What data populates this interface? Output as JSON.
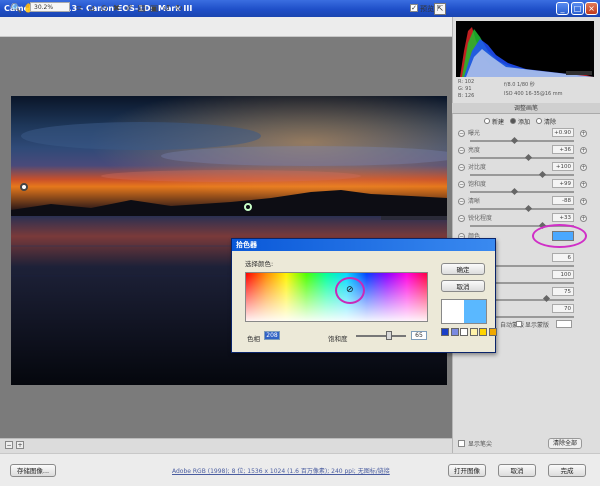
{
  "window": {
    "title": "Camera Raw 5.3 -  Canon EOS-1Ds Mark III",
    "buttons": [
      "_",
      "□",
      "×"
    ]
  },
  "toolbar": {
    "tools": [
      {
        "name": "zoom-tool-icon",
        "glyph": "🔍"
      },
      {
        "name": "hand-tool-icon",
        "glyph": "✋"
      },
      {
        "name": "white-balance-tool-icon",
        "glyph": "✎"
      },
      {
        "name": "color-sampler-tool-icon",
        "glyph": "✎"
      },
      {
        "name": "targeted-adjustment-tool-icon",
        "glyph": "◎"
      },
      {
        "name": "crop-tool-icon",
        "glyph": "⌗"
      },
      {
        "name": "straighten-tool-icon",
        "glyph": "⊿"
      },
      {
        "name": "red-eye-tool-icon",
        "glyph": "⊙"
      },
      {
        "name": "spot-removal-tool-icon",
        "glyph": "✖"
      },
      {
        "name": "adjustment-brush-icon",
        "glyph": "✐"
      },
      {
        "name": "graduated-filter-icon",
        "glyph": "▤"
      },
      {
        "name": "preferences-icon",
        "glyph": "▣"
      },
      {
        "name": "rotate-left-icon",
        "glyph": "↺"
      },
      {
        "name": "rotate-right-icon",
        "glyph": "↻"
      }
    ],
    "preview_label": "预览",
    "preview_checked": true
  },
  "histogram": {
    "rgb_r": "R:  102",
    "rgb_g": "G:   91",
    "rgb_b": "B:  126",
    "exposure": "f/8.0   1/80 秒",
    "iso": "ISO 400   16-35@16 mm"
  },
  "panel": {
    "title": "调整画笔",
    "modes": [
      "新建",
      "添加",
      "清除"
    ],
    "selected_mode": "添加",
    "sliders": [
      {
        "label": "曝光",
        "value": "+0.90"
      },
      {
        "label": "亮度",
        "value": "+36"
      },
      {
        "label": "对比度",
        "value": "+100"
      },
      {
        "label": "饱和度",
        "value": "+99"
      },
      {
        "label": "清晰",
        "value": "-88"
      },
      {
        "label": "锐化程度",
        "value": "+33"
      }
    ],
    "color_label": "颜色",
    "color_value": "#4aa8ff",
    "brush_values": [
      "6",
      "100",
      "75",
      "70"
    ],
    "show_mask_label": "显示蒙版",
    "auto_mask_label": "自动蒙版",
    "show_pins_label": "显示笔尖",
    "clear_all_label": "清除全部"
  },
  "canvas": {
    "zoom": "30.2%"
  },
  "footer": {
    "save_label": "存储图像...",
    "file_info": "Adobe RGB (1998); 8 位; 1536 x 1024 (1.6 百万像素); 240 ppi; 无图标/链接",
    "open_label": "打开图像",
    "cancel_label": "取消",
    "done_label": "完成"
  },
  "dialog": {
    "title": "拾色器",
    "pick_label": "选择颜色:",
    "ok_label": "确定",
    "cancel_label": "取消",
    "hue_label": "色相",
    "hue_value": "208",
    "saturation_label": "饱和度",
    "saturation_value": "65",
    "saturation_fraction": 0.65,
    "swatches": [
      "#1a3fc8",
      "#7a8ae0",
      "#ffffff",
      "#fff2a8",
      "#ffd400",
      "#f0a800"
    ],
    "preview_old": "#ffffff",
    "preview_new": "#5ab8ff"
  }
}
